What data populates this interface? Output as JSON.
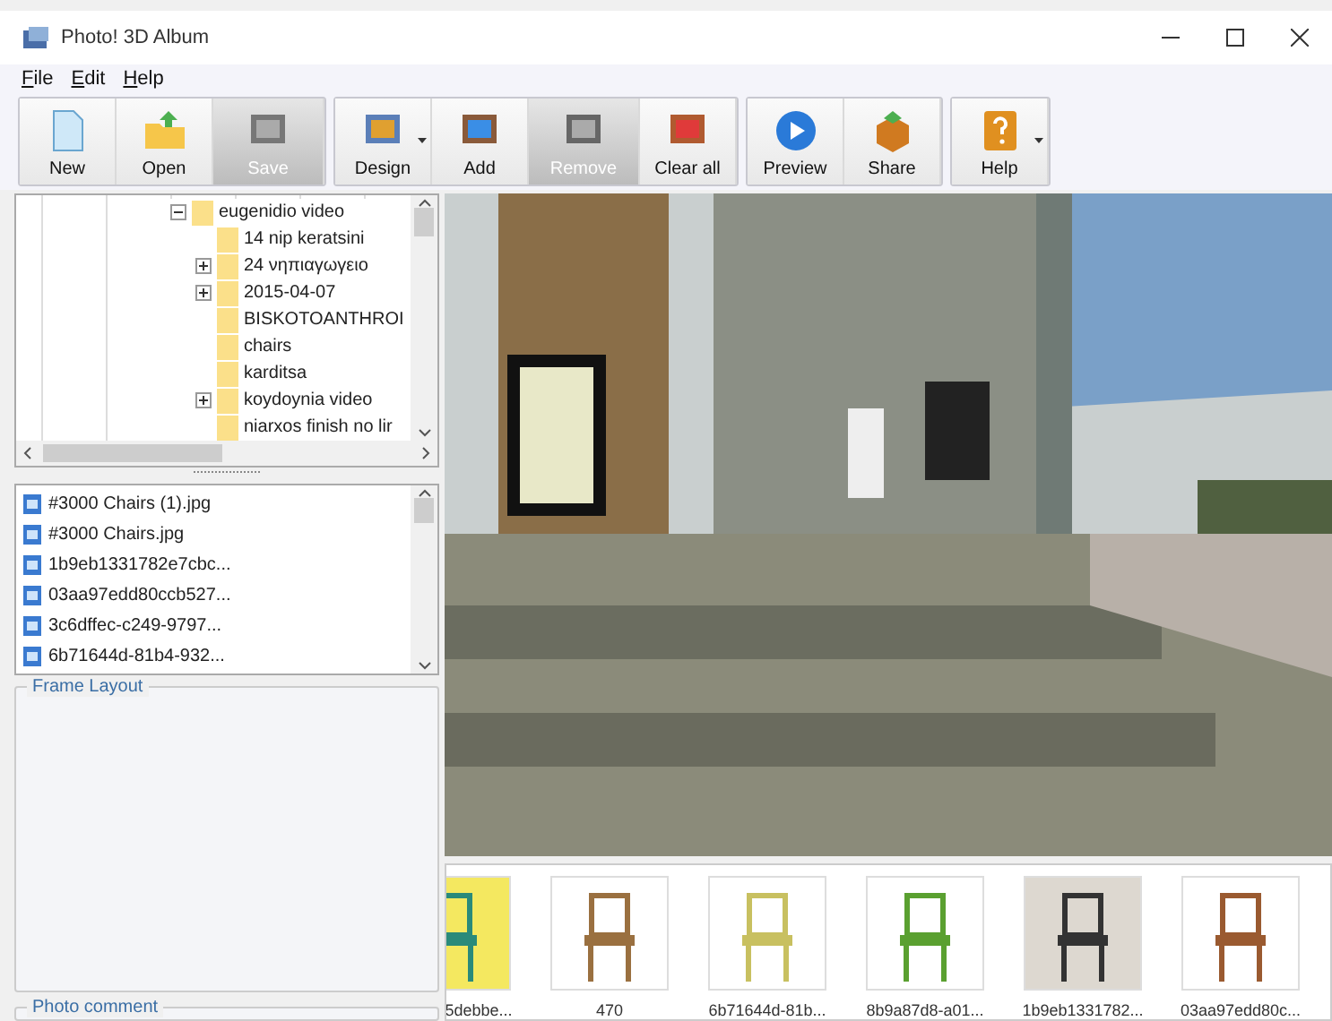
{
  "window": {
    "title": "Photo! 3D Album"
  },
  "menu": [
    "File",
    "Edit",
    "Help"
  ],
  "toolbar": [
    [
      {
        "label": "New",
        "disabled": false,
        "dropdown": false
      },
      {
        "label": "Open",
        "disabled": false,
        "dropdown": false
      },
      {
        "label": "Save",
        "disabled": true,
        "dropdown": false
      }
    ],
    [
      {
        "label": "Design",
        "disabled": false,
        "dropdown": true
      },
      {
        "label": "Add",
        "disabled": false,
        "dropdown": false
      },
      {
        "label": "Remove",
        "disabled": true,
        "dropdown": false
      },
      {
        "label": "Clear all",
        "disabled": false,
        "dropdown": false
      }
    ],
    [
      {
        "label": "Preview",
        "disabled": false,
        "dropdown": false
      },
      {
        "label": "Share",
        "disabled": false,
        "dropdown": false
      }
    ],
    [
      {
        "label": "Help",
        "disabled": false,
        "dropdown": true
      }
    ]
  ],
  "folder_tree": [
    {
      "label": "eugenidio video",
      "kind": "expanded",
      "children": [
        {
          "label": "14 nip keratsini",
          "kind": "leaf"
        },
        {
          "label": "24 νηπιαγωγειο",
          "kind": "collapsed"
        },
        {
          "label": "2015-04-07",
          "kind": "collapsed"
        },
        {
          "label": "BISKOTOANTHROI",
          "kind": "leaf"
        },
        {
          "label": "chairs",
          "kind": "leaf"
        },
        {
          "label": "karditsa",
          "kind": "leaf"
        },
        {
          "label": "koydoynia video",
          "kind": "collapsed"
        },
        {
          "label": "niarxos finish no lir",
          "kind": "leaf"
        }
      ]
    }
  ],
  "files": [
    "#3000 Chairs (1).jpg",
    "#3000 Chairs.jpg",
    "1b9eb1331782e7cbc...",
    "03aa97edd80ccb527...",
    "3c6dffec-c249-9797...",
    "6b71644d-81b4-932..."
  ],
  "frame_layout": {
    "title": "Frame Layout"
  },
  "photo_comment": {
    "title": "Photo comment"
  },
  "view": {
    "kind": "picture"
  },
  "thumbnails": [
    {
      "caption": "5debbe...",
      "kind": "picture"
    },
    {
      "caption": "470",
      "kind": "picture"
    },
    {
      "caption": "6b71644d-81b...",
      "kind": "picture"
    },
    {
      "caption": "8b9a87d8-a01...",
      "kind": "picture"
    },
    {
      "caption": "1b9eb1331782...",
      "kind": "picture"
    },
    {
      "caption": "03aa97edd80c...",
      "kind": "picture"
    }
  ]
}
